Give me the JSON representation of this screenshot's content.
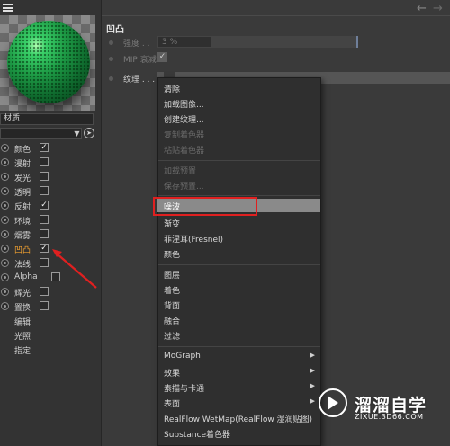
{
  "left_panel": {
    "material_name": "材质",
    "channels": [
      {
        "label": "颜色",
        "checked": true,
        "active": false
      },
      {
        "label": "漫射",
        "checked": false,
        "active": false
      },
      {
        "label": "发光",
        "checked": false,
        "active": false
      },
      {
        "label": "透明",
        "checked": false,
        "active": false
      },
      {
        "label": "反射",
        "checked": true,
        "active": false
      },
      {
        "label": "环境",
        "checked": false,
        "active": false
      },
      {
        "label": "烟雾",
        "checked": false,
        "active": false
      },
      {
        "label": "凹凸",
        "checked": true,
        "active": true
      },
      {
        "label": "法线",
        "checked": false,
        "active": false
      },
      {
        "label": "Alpha",
        "checked": false,
        "active": false
      },
      {
        "label": "辉光",
        "checked": false,
        "active": false
      },
      {
        "label": "置换",
        "checked": false,
        "active": false
      }
    ],
    "extra_items": [
      "编辑",
      "光照",
      "指定"
    ]
  },
  "right_panel": {
    "section_title": "凹凸",
    "strength_label": "强度 . .",
    "strength_value": "3 %",
    "mip_label": "MIP 衰减",
    "texture_label": "纹理 . . ."
  },
  "context_menu": {
    "items": [
      {
        "label": "清除",
        "disabled": false
      },
      {
        "label": "加载图像...",
        "disabled": false
      },
      {
        "label": "创建纹理...",
        "disabled": false
      },
      {
        "label": "复制着色器",
        "disabled": true
      },
      {
        "label": "粘贴着色器",
        "disabled": true
      },
      {
        "label": "加载预置",
        "disabled": true
      },
      {
        "label": "保存预置...",
        "disabled": true
      },
      {
        "label": "噪波",
        "disabled": false,
        "highlighted": true
      },
      {
        "label": "渐变",
        "disabled": false
      },
      {
        "label": "菲涅耳(Fresnel)",
        "disabled": false
      },
      {
        "label": "颜色",
        "disabled": false
      },
      {
        "label": "图层",
        "disabled": false
      },
      {
        "label": "着色",
        "disabled": false
      },
      {
        "label": "背面",
        "disabled": false
      },
      {
        "label": "融合",
        "disabled": false
      },
      {
        "label": "过滤",
        "disabled": false
      },
      {
        "label": "MoGraph",
        "disabled": false,
        "submenu": true
      },
      {
        "label": "效果",
        "disabled": false,
        "submenu": true
      },
      {
        "label": "素描与卡通",
        "disabled": false,
        "submenu": true
      },
      {
        "label": "表面",
        "disabled": false,
        "submenu": true
      },
      {
        "label": "RealFlow WetMap(RealFlow 湿润贴图)",
        "disabled": false
      },
      {
        "label": "Substance着色器",
        "disabled": false
      }
    ]
  },
  "watermark": {
    "title": "溜溜自学",
    "url": "ZIXUE.3D66.COM"
  },
  "icons": {
    "menu": "hamburger-menu-icon",
    "back": "arrow-left-icon",
    "forward": "arrow-right-icon",
    "picker": "eyedropper-icon",
    "dropdown": "chevron-down-icon",
    "check": "checkmark-icon",
    "submenu": "triangle-right-icon",
    "annotation": "red-arrow-annotation",
    "watermark_logo": "play-logo-icon"
  },
  "colors": {
    "active_channel": "#f0a030",
    "highlight_box": "#e02020",
    "menu_highlight": "#8a8a8a"
  }
}
